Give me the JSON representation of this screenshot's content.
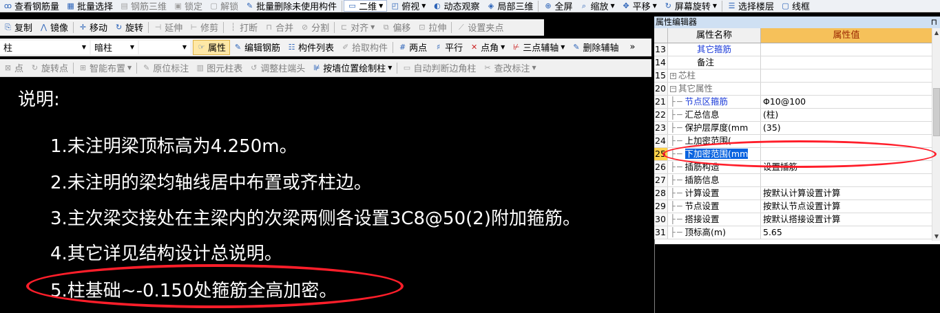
{
  "toolbar1": {
    "items": [
      "查看钢筋量",
      "批量选择",
      "钢筋三维",
      "锁定",
      "解锁",
      "批量删除未使用构件",
      "二维",
      "俯视",
      "动态观察",
      "局部三维",
      "全屏",
      "缩放",
      "平移",
      "屏幕旋转",
      "选择楼层",
      "线框"
    ]
  },
  "toolbar2": {
    "items": [
      "复制",
      "镜像",
      "移动",
      "旋转",
      "延伸",
      "修剪",
      "打断",
      "合并",
      "分割",
      "对齐",
      "偏移",
      "拉伸",
      "设置夹点"
    ]
  },
  "toolbar3": {
    "dropdown1": "柱",
    "dropdown2": "暗柱",
    "dropdown3": "",
    "items": [
      "属性",
      "编辑钢筋",
      "构件列表",
      "拾取构件",
      "两点",
      "平行",
      "点角",
      "三点辅轴",
      "删除辅轴"
    ],
    "more": "»"
  },
  "toolbar4": {
    "items": [
      "点",
      "旋转点",
      "智能布置",
      "原位标注",
      "图元柱表",
      "调整柱端头",
      "按墙位置绘制柱",
      "自动判断边角柱",
      "查改标注"
    ]
  },
  "notes": {
    "heading": "说明:",
    "lines": [
      "1.未注明梁顶标高为4.250m。",
      "2.未注明的梁均轴线居中布置或齐柱边。",
      "3.主次梁交接处在主梁内的次梁两侧各设置3C8@50(2)附加箍筋。",
      "4.其它详见结构设计总说明。",
      "5.柱基础~-0.150处箍筋全高加密。"
    ]
  },
  "property_panel": {
    "title": "属性编辑器",
    "pin": "⊓",
    "col_name": "属性名称",
    "col_value": "属性值",
    "rows": [
      {
        "n": "13",
        "k": "其它箍筋",
        "v": ""
      },
      {
        "n": "14",
        "k": "备注",
        "v": ""
      },
      {
        "n": "15",
        "k": "芯柱",
        "v": ""
      },
      {
        "n": "20",
        "k": "其它属性",
        "v": ""
      },
      {
        "n": "21",
        "k": "节点区箍筋",
        "v": "Φ10@100"
      },
      {
        "n": "22",
        "k": "汇总信息",
        "v": "(柱)"
      },
      {
        "n": "23",
        "k": "保护层厚度(mm",
        "v": "(35)"
      },
      {
        "n": "24",
        "k": "上加密范围(",
        "v": ""
      },
      {
        "n": "25",
        "k": "下加密范围(mm",
        "v": ""
      },
      {
        "n": "26",
        "k": "插筋构造",
        "v": "设置插筋"
      },
      {
        "n": "27",
        "k": "插筋信息",
        "v": ""
      },
      {
        "n": "28",
        "k": "计算设置",
        "v": "按默认计算设置计算"
      },
      {
        "n": "29",
        "k": "节点设置",
        "v": "按默认节点设置计算"
      },
      {
        "n": "30",
        "k": "搭接设置",
        "v": "按默认搭接设置计算"
      },
      {
        "n": "31",
        "k": "顶标高(m)",
        "v": "5.65"
      }
    ]
  },
  "colors": {
    "annotation_red": "#ff1e2a",
    "selection_blue": "#0a64e0",
    "header_value": "#f6c15a"
  }
}
